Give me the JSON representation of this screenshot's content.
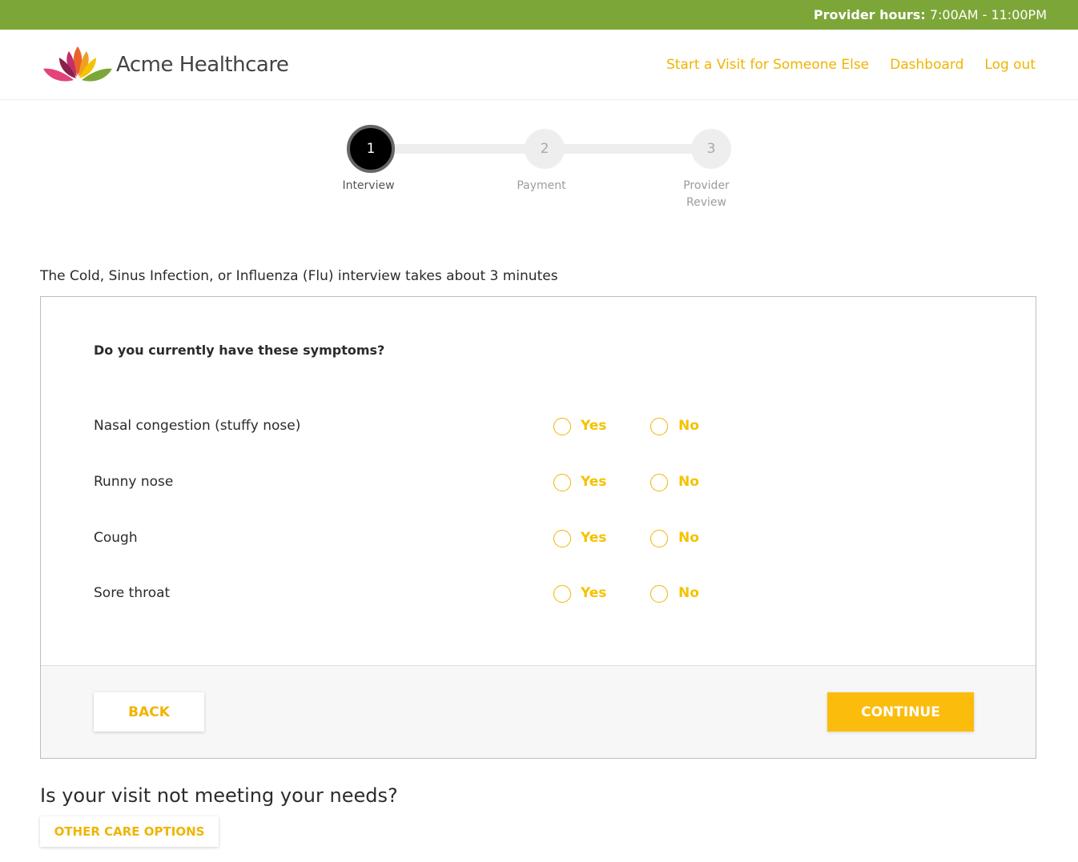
{
  "topbar": {
    "hours_label": "Provider hours:",
    "hours_value": "7:00AM - 11:00PM"
  },
  "header": {
    "brand": "Acme Healthcare",
    "nav": [
      "Start a Visit for Someone Else",
      "Dashboard",
      "Log out"
    ]
  },
  "stepper": {
    "current_step": 1,
    "steps": [
      {
        "number": "1",
        "label": "Interview"
      },
      {
        "number": "2",
        "label": "Payment"
      },
      {
        "number": "3",
        "label": "Provider Review"
      }
    ]
  },
  "intro": "The Cold, Sinus Infection, or Influenza (Flu) interview takes about 3 minutes",
  "form": {
    "question": "Do you currently have these symptoms?",
    "yes_label": "Yes",
    "no_label": "No",
    "symptoms": [
      "Nasal congestion (stuffy nose)",
      "Runny nose",
      "Cough",
      "Sore throat"
    ]
  },
  "buttons": {
    "back": "BACK",
    "continue": "CONTINUE"
  },
  "footer": {
    "needs_text": "Is your visit not meeting your needs?",
    "other_options": "OTHER CARE OPTIONS"
  },
  "colors": {
    "topbar": "#7da638",
    "accent": "#f0b400",
    "continue_bg": "#fbbc0c"
  }
}
